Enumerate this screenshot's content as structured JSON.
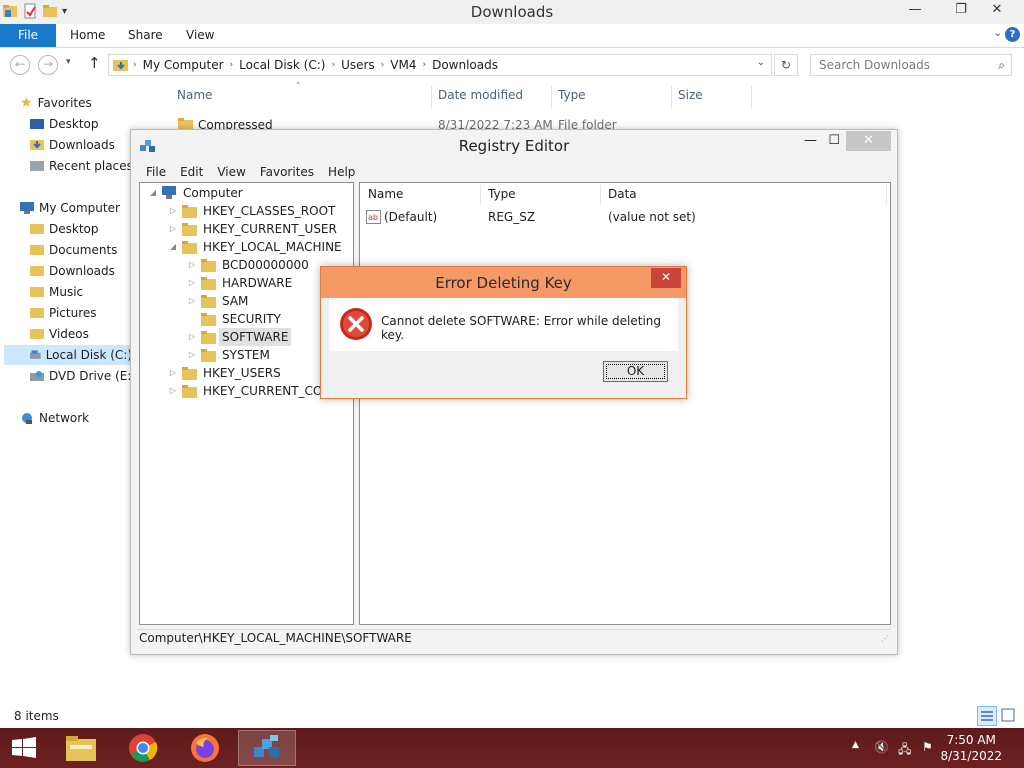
{
  "explorer": {
    "title": "Downloads",
    "ribbon_tabs": {
      "file": "File",
      "home": "Home",
      "share": "Share",
      "view": "View"
    },
    "address": {
      "segments": [
        "My Computer",
        "Local Disk (C:)",
        "Users",
        "VM4",
        "Downloads"
      ]
    },
    "search_placeholder": "Search Downloads",
    "nav": {
      "favorites": "Favorites",
      "desktop": "Desktop",
      "downloads": "Downloads",
      "recent": "Recent places",
      "my_computer": "My Computer",
      "pc_desktop": "Desktop",
      "documents": "Documents",
      "pc_downloads": "Downloads",
      "music": "Music",
      "pictures": "Pictures",
      "videos": "Videos",
      "local_disk": "Local Disk (C:)",
      "dvd": "DVD Drive (E:) E",
      "network": "Network"
    },
    "columns": {
      "name": "Name",
      "date": "Date modified",
      "type": "Type",
      "size": "Size"
    },
    "file": {
      "name": "Compressed",
      "date": "8/31/2022 7:23 AM",
      "type": "File folder"
    },
    "status": "8 items"
  },
  "regedit": {
    "title": "Registry Editor",
    "menu": {
      "file": "File",
      "edit": "Edit",
      "view": "View",
      "favorites": "Favorites",
      "help": "Help"
    },
    "tree": {
      "computer": "Computer",
      "hkcr": "HKEY_CLASSES_ROOT",
      "hkcu": "HKEY_CURRENT_USER",
      "hklm": "HKEY_LOCAL_MACHINE",
      "bcd": "BCD00000000",
      "hardware": "HARDWARE",
      "sam": "SAM",
      "security": "SECURITY",
      "software": "SOFTWARE",
      "system": "SYSTEM",
      "hku": "HKEY_USERS",
      "hkcc": "HKEY_CURRENT_CONFIG"
    },
    "list_columns": {
      "name": "Name",
      "type": "Type",
      "data": "Data"
    },
    "value": {
      "name": "(Default)",
      "type": "REG_SZ",
      "data": "(value not set)"
    },
    "status_path": "Computer\\HKEY_LOCAL_MACHINE\\SOFTWARE"
  },
  "error_dialog": {
    "title": "Error Deleting Key",
    "message": "Cannot delete SOFTWARE:  Error while deleting key.",
    "ok_label": "OK"
  },
  "taskbar": {
    "apps": [
      "file-explorer-icon",
      "chrome-icon",
      "firefox-icon",
      "regedit-icon"
    ],
    "time": "7:50 AM",
    "date": "8/31/2022"
  },
  "colors": {
    "ribbon_file": "#1979ca",
    "dialog_accent": "#f59a66",
    "taskbar": "#6b1f1f",
    "error_red": "#c42b1c"
  }
}
